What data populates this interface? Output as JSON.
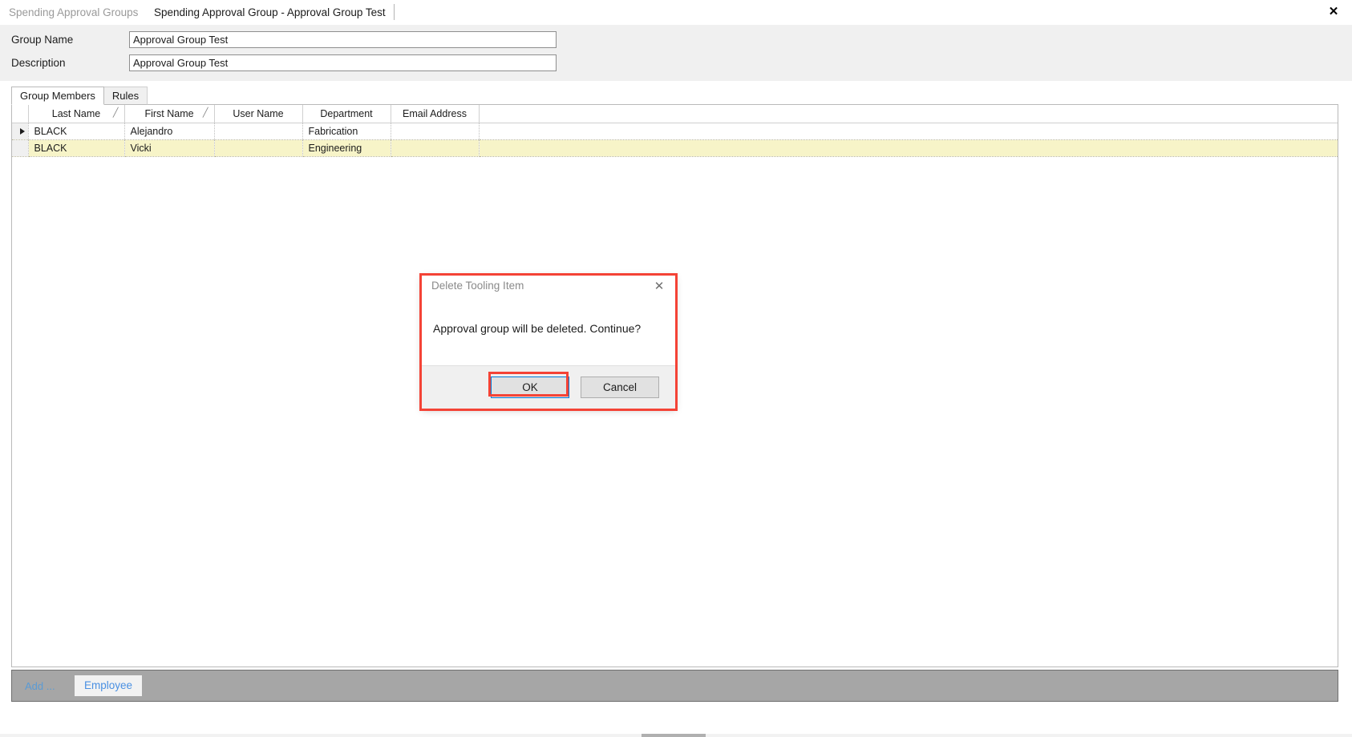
{
  "window": {
    "close_icon": "close-icon",
    "close_glyph": "✕"
  },
  "top_tabs": [
    {
      "label": "Spending Approval Groups",
      "active": false
    },
    {
      "label": "Spending Approval Group - Approval Group Test",
      "active": true
    }
  ],
  "form": {
    "group_name_label": "Group Name",
    "group_name_value": "Approval Group Test",
    "description_label": "Description",
    "description_value": "Approval Group Test"
  },
  "sub_tabs": [
    {
      "label": "Group Members",
      "active": true
    },
    {
      "label": "Rules",
      "active": false
    }
  ],
  "grid": {
    "columns": [
      {
        "label": "Last Name",
        "sort_indicator": "╱"
      },
      {
        "label": "First Name",
        "sort_indicator": "╱"
      },
      {
        "label": "User Name",
        "sort_indicator": ""
      },
      {
        "label": "Department",
        "sort_indicator": ""
      },
      {
        "label": "Email Address",
        "sort_indicator": ""
      }
    ],
    "rows": [
      {
        "selected": false,
        "current": true,
        "last_name": "BLACK",
        "first_name": "Alejandro",
        "user_name": "",
        "department": "Fabrication",
        "email_address": ""
      },
      {
        "selected": true,
        "current": false,
        "last_name": "BLACK",
        "first_name": "Vicki",
        "user_name": "",
        "department": "Engineering",
        "email_address": ""
      }
    ]
  },
  "bottom_bar": {
    "add_label": "Add ...",
    "employee_button": "Employee"
  },
  "dialog": {
    "title": "Delete Tooling Item",
    "close_glyph": "✕",
    "message": "Approval group will be deleted.  Continue?",
    "ok_label": "OK",
    "cancel_label": "Cancel"
  },
  "colors": {
    "highlight_red": "#f44336",
    "focus_blue": "#0078d7",
    "selected_row": "#f7f4c8",
    "bottom_bar": "#a6a6a6",
    "link_blue": "#5a9bd5"
  }
}
